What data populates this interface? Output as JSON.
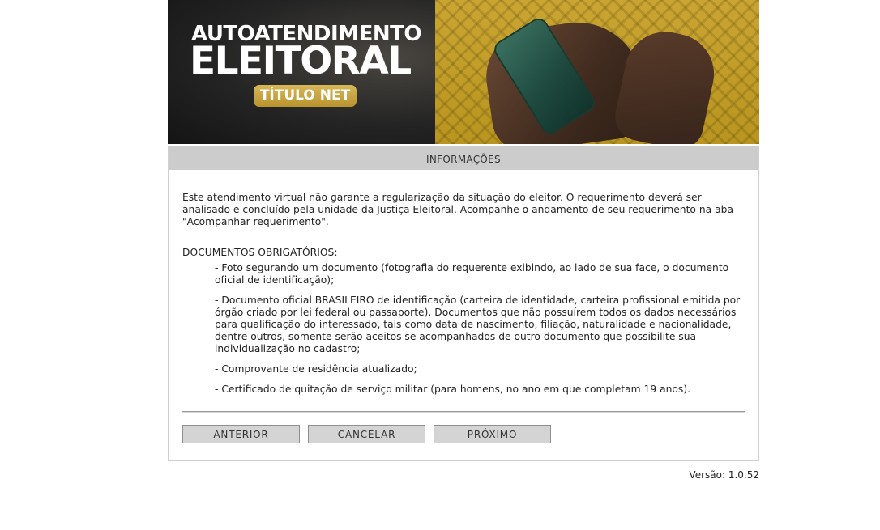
{
  "banner": {
    "title_line1": "AUTOATENDIMENTO",
    "title_line2": "ELEITORAL",
    "badge": "TÍTULO NET"
  },
  "panel": {
    "header": "INFORMAÇÕES",
    "intro": "Este atendimento virtual não garante a regularização da situação do eleitor. O requerimento deverá ser analisado e concluído pela unidade da Justiça Eleitoral. Acompanhe o andamento de seu requerimento na aba \"Acompanhar requerimento\".",
    "docs_title": "DOCUMENTOS OBRIGATÓRIOS:",
    "docs": [
      "- Foto segurando um documento (fotografia do requerente exibindo, ao lado de sua face, o documento oficial de identificação);",
      "- Documento oficial BRASILEIRO de identificação (carteira de identidade, carteira profissional emitida por órgão criado por lei federal ou passaporte). Documentos que não possuírem todos os dados necessários para qualificação do interessado, tais como data de nascimento, filiação, naturalidade e nacionalidade, dentre outros, somente serão aceitos se acompanhados de outro documento que possibilite sua individualização no cadastro;",
      "- Comprovante de residência atualizado;",
      "- Certificado de quitação de serviço militar (para homens, no ano em que completam 19 anos)."
    ]
  },
  "buttons": {
    "previous": "ANTERIOR",
    "cancel": "CANCELAR",
    "next": "PRÓXIMO"
  },
  "footer": {
    "version": "Versão: 1.0.52"
  },
  "colors": {
    "header_bg": "#cccccc",
    "button_bg": "#d4d4d4",
    "badge_gold": "#c9a84a"
  }
}
